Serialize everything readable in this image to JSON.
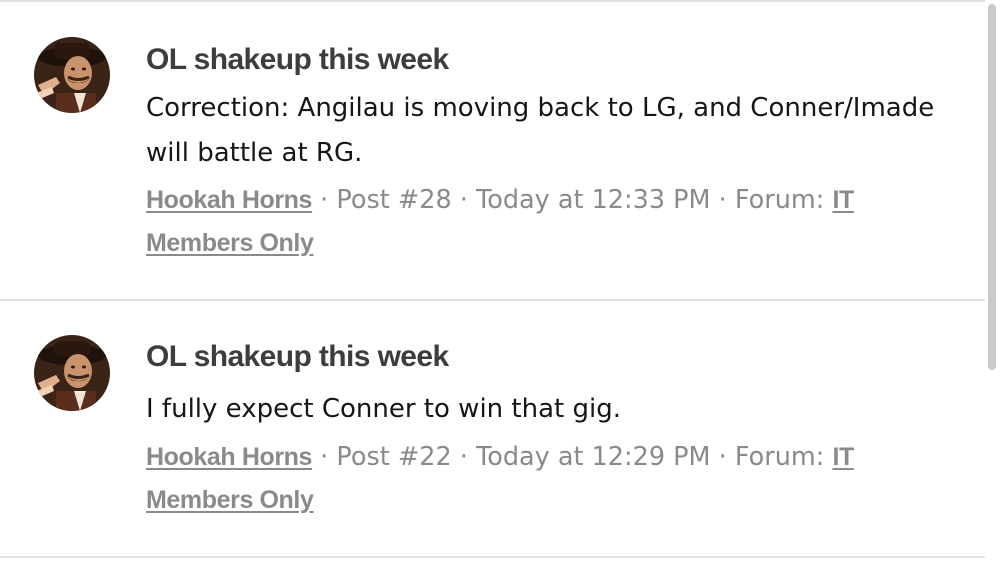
{
  "results": [
    {
      "title": "OL shakeup this week",
      "snippet": "Correction: Angilau is moving back to LG, and Conner/Imade will battle at RG.",
      "author": "Hookah Horns",
      "sep1": " · ",
      "post": "Post #28",
      "sep2": " · ",
      "time": "Today at 12:33 PM",
      "sep3": " · ",
      "forum_label": "Forum: ",
      "forum_name": "IT Members Only",
      "avatar_icon": "user-avatar-icon"
    },
    {
      "title": "OL shakeup this week",
      "snippet": "I fully expect Conner to win that gig.",
      "author": "Hookah Horns",
      "sep1": " · ",
      "post": "Post #22",
      "sep2": " · ",
      "time": "Today at 12:29 PM",
      "sep3": " · ",
      "forum_label": "Forum: ",
      "forum_name": "IT Members Only",
      "avatar_icon": "user-avatar-icon"
    }
  ],
  "colors": {
    "title": "#3d3d3d",
    "meta": "#8a8a8a",
    "text": "#161616",
    "divider": "#e3e3e3"
  }
}
